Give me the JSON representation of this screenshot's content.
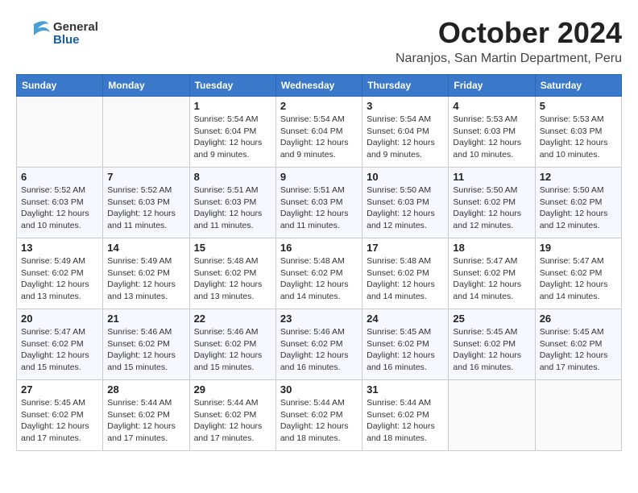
{
  "header": {
    "logo_general": "General",
    "logo_blue": "Blue",
    "month": "October 2024",
    "location": "Naranjos, San Martin Department, Peru"
  },
  "weekdays": [
    "Sunday",
    "Monday",
    "Tuesday",
    "Wednesday",
    "Thursday",
    "Friday",
    "Saturday"
  ],
  "weeks": [
    [
      {
        "day": "",
        "info": ""
      },
      {
        "day": "",
        "info": ""
      },
      {
        "day": "1",
        "info": "Sunrise: 5:54 AM\nSunset: 6:04 PM\nDaylight: 12 hours and 9 minutes."
      },
      {
        "day": "2",
        "info": "Sunrise: 5:54 AM\nSunset: 6:04 PM\nDaylight: 12 hours and 9 minutes."
      },
      {
        "day": "3",
        "info": "Sunrise: 5:54 AM\nSunset: 6:04 PM\nDaylight: 12 hours and 9 minutes."
      },
      {
        "day": "4",
        "info": "Sunrise: 5:53 AM\nSunset: 6:03 PM\nDaylight: 12 hours and 10 minutes."
      },
      {
        "day": "5",
        "info": "Sunrise: 5:53 AM\nSunset: 6:03 PM\nDaylight: 12 hours and 10 minutes."
      }
    ],
    [
      {
        "day": "6",
        "info": "Sunrise: 5:52 AM\nSunset: 6:03 PM\nDaylight: 12 hours and 10 minutes."
      },
      {
        "day": "7",
        "info": "Sunrise: 5:52 AM\nSunset: 6:03 PM\nDaylight: 12 hours and 11 minutes."
      },
      {
        "day": "8",
        "info": "Sunrise: 5:51 AM\nSunset: 6:03 PM\nDaylight: 12 hours and 11 minutes."
      },
      {
        "day": "9",
        "info": "Sunrise: 5:51 AM\nSunset: 6:03 PM\nDaylight: 12 hours and 11 minutes."
      },
      {
        "day": "10",
        "info": "Sunrise: 5:50 AM\nSunset: 6:03 PM\nDaylight: 12 hours and 12 minutes."
      },
      {
        "day": "11",
        "info": "Sunrise: 5:50 AM\nSunset: 6:02 PM\nDaylight: 12 hours and 12 minutes."
      },
      {
        "day": "12",
        "info": "Sunrise: 5:50 AM\nSunset: 6:02 PM\nDaylight: 12 hours and 12 minutes."
      }
    ],
    [
      {
        "day": "13",
        "info": "Sunrise: 5:49 AM\nSunset: 6:02 PM\nDaylight: 12 hours and 13 minutes."
      },
      {
        "day": "14",
        "info": "Sunrise: 5:49 AM\nSunset: 6:02 PM\nDaylight: 12 hours and 13 minutes."
      },
      {
        "day": "15",
        "info": "Sunrise: 5:48 AM\nSunset: 6:02 PM\nDaylight: 12 hours and 13 minutes."
      },
      {
        "day": "16",
        "info": "Sunrise: 5:48 AM\nSunset: 6:02 PM\nDaylight: 12 hours and 14 minutes."
      },
      {
        "day": "17",
        "info": "Sunrise: 5:48 AM\nSunset: 6:02 PM\nDaylight: 12 hours and 14 minutes."
      },
      {
        "day": "18",
        "info": "Sunrise: 5:47 AM\nSunset: 6:02 PM\nDaylight: 12 hours and 14 minutes."
      },
      {
        "day": "19",
        "info": "Sunrise: 5:47 AM\nSunset: 6:02 PM\nDaylight: 12 hours and 14 minutes."
      }
    ],
    [
      {
        "day": "20",
        "info": "Sunrise: 5:47 AM\nSunset: 6:02 PM\nDaylight: 12 hours and 15 minutes."
      },
      {
        "day": "21",
        "info": "Sunrise: 5:46 AM\nSunset: 6:02 PM\nDaylight: 12 hours and 15 minutes."
      },
      {
        "day": "22",
        "info": "Sunrise: 5:46 AM\nSunset: 6:02 PM\nDaylight: 12 hours and 15 minutes."
      },
      {
        "day": "23",
        "info": "Sunrise: 5:46 AM\nSunset: 6:02 PM\nDaylight: 12 hours and 16 minutes."
      },
      {
        "day": "24",
        "info": "Sunrise: 5:45 AM\nSunset: 6:02 PM\nDaylight: 12 hours and 16 minutes."
      },
      {
        "day": "25",
        "info": "Sunrise: 5:45 AM\nSunset: 6:02 PM\nDaylight: 12 hours and 16 minutes."
      },
      {
        "day": "26",
        "info": "Sunrise: 5:45 AM\nSunset: 6:02 PM\nDaylight: 12 hours and 17 minutes."
      }
    ],
    [
      {
        "day": "27",
        "info": "Sunrise: 5:45 AM\nSunset: 6:02 PM\nDaylight: 12 hours and 17 minutes."
      },
      {
        "day": "28",
        "info": "Sunrise: 5:44 AM\nSunset: 6:02 PM\nDaylight: 12 hours and 17 minutes."
      },
      {
        "day": "29",
        "info": "Sunrise: 5:44 AM\nSunset: 6:02 PM\nDaylight: 12 hours and 17 minutes."
      },
      {
        "day": "30",
        "info": "Sunrise: 5:44 AM\nSunset: 6:02 PM\nDaylight: 12 hours and 18 minutes."
      },
      {
        "day": "31",
        "info": "Sunrise: 5:44 AM\nSunset: 6:02 PM\nDaylight: 12 hours and 18 minutes."
      },
      {
        "day": "",
        "info": ""
      },
      {
        "day": "",
        "info": ""
      }
    ]
  ]
}
